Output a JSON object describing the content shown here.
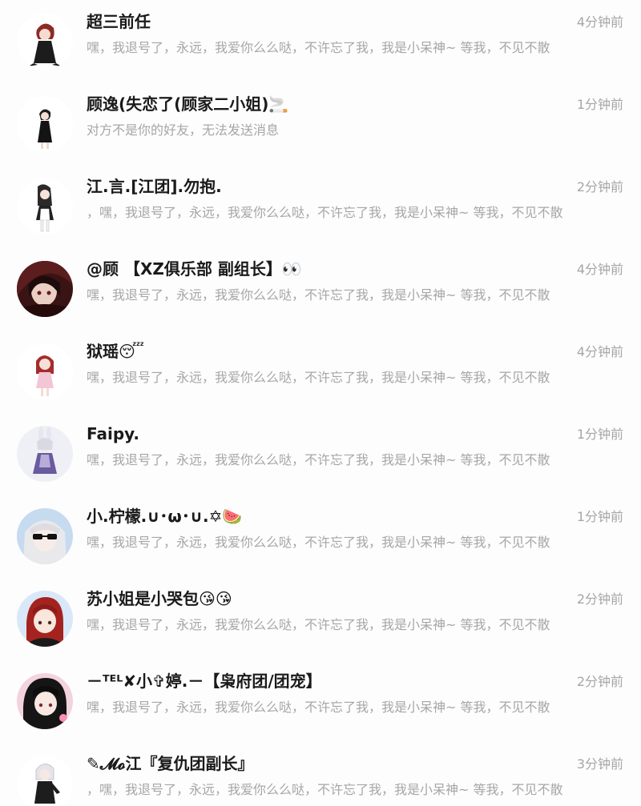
{
  "conversations": [
    {
      "name": "超三前任",
      "preview": "嘿，我退号了，永远，我爱你么么哒，不许忘了我，我是小呆神~ 等我，不见不散",
      "time": "4分钟前",
      "avatar": "chibi-red-hair-icon"
    },
    {
      "name": "顾逸(失恋了(顾家二小姐)🚬",
      "preview": "对方不是你的好友，无法发送消息",
      "time": "1分钟前",
      "avatar": "chibi-black-dress-icon"
    },
    {
      "name": "江.言.[江团].勿抱.",
      "preview": "，嘿，我退号了，永远，我爱你么么哒，不许忘了我，我是小呆神~ 等我，不见不散",
      "time": "2分钟前",
      "avatar": "chibi-maid-icon"
    },
    {
      "name": "@顾 【XZ俱乐部 副组长】👀",
      "preview": "嘿，我退号了，永远，我爱你么么哒，不许忘了我，我是小呆神~ 等我，不见不散",
      "time": "4分钟前",
      "avatar": "dark-portrait-icon"
    },
    {
      "name": "狱瑶😴",
      "preview": "嘿，我退号了，永远，我爱你么么哒，不许忘了我，我是小呆神~ 等我，不见不散",
      "time": "4分钟前",
      "avatar": "chibi-pink-girl-icon"
    },
    {
      "name": "Faipy.",
      "preview": "嘿，我退号了，永远，我爱你么么哒，不许忘了我，我是小呆神~ 等我，不见不散",
      "time": "1分钟前",
      "avatar": "chibi-bunny-girl-icon"
    },
    {
      "name": "小.柠檬.∪･ω･∪.✡🍉",
      "preview": "嘿，我退号了，永远，我爱你么么哒，不许忘了我，我是小呆神~ 等我，不见不散",
      "time": "1分钟前",
      "avatar": "sunglasses-girl-icon"
    },
    {
      "name": "苏小姐是小哭包😘😘",
      "preview": "嘿，我退号了，永远，我爱你么么哒，不许忘了我，我是小呆神~ 等我，不见不散",
      "time": "2分钟前",
      "avatar": "red-hair-girl-icon"
    },
    {
      "name": "－ᵀᴱᴸ✘小✞婷.－【枭府团/团宠】",
      "preview": "嘿，我退号了，永远，我爱你么么哒，不许忘了我，我是小呆神~ 等我，不见不散",
      "time": "2分钟前",
      "avatar": "black-hair-girl-icon"
    },
    {
      "name": "✎𝓜𝓸江『复仇团副长』",
      "preview": "，嘿，我退号了，永远，我爱你么么哒，不许忘了我，我是小呆神~ 等我，不见不散",
      "time": "3分钟前",
      "avatar": "chibi-white-hair-icon"
    }
  ]
}
